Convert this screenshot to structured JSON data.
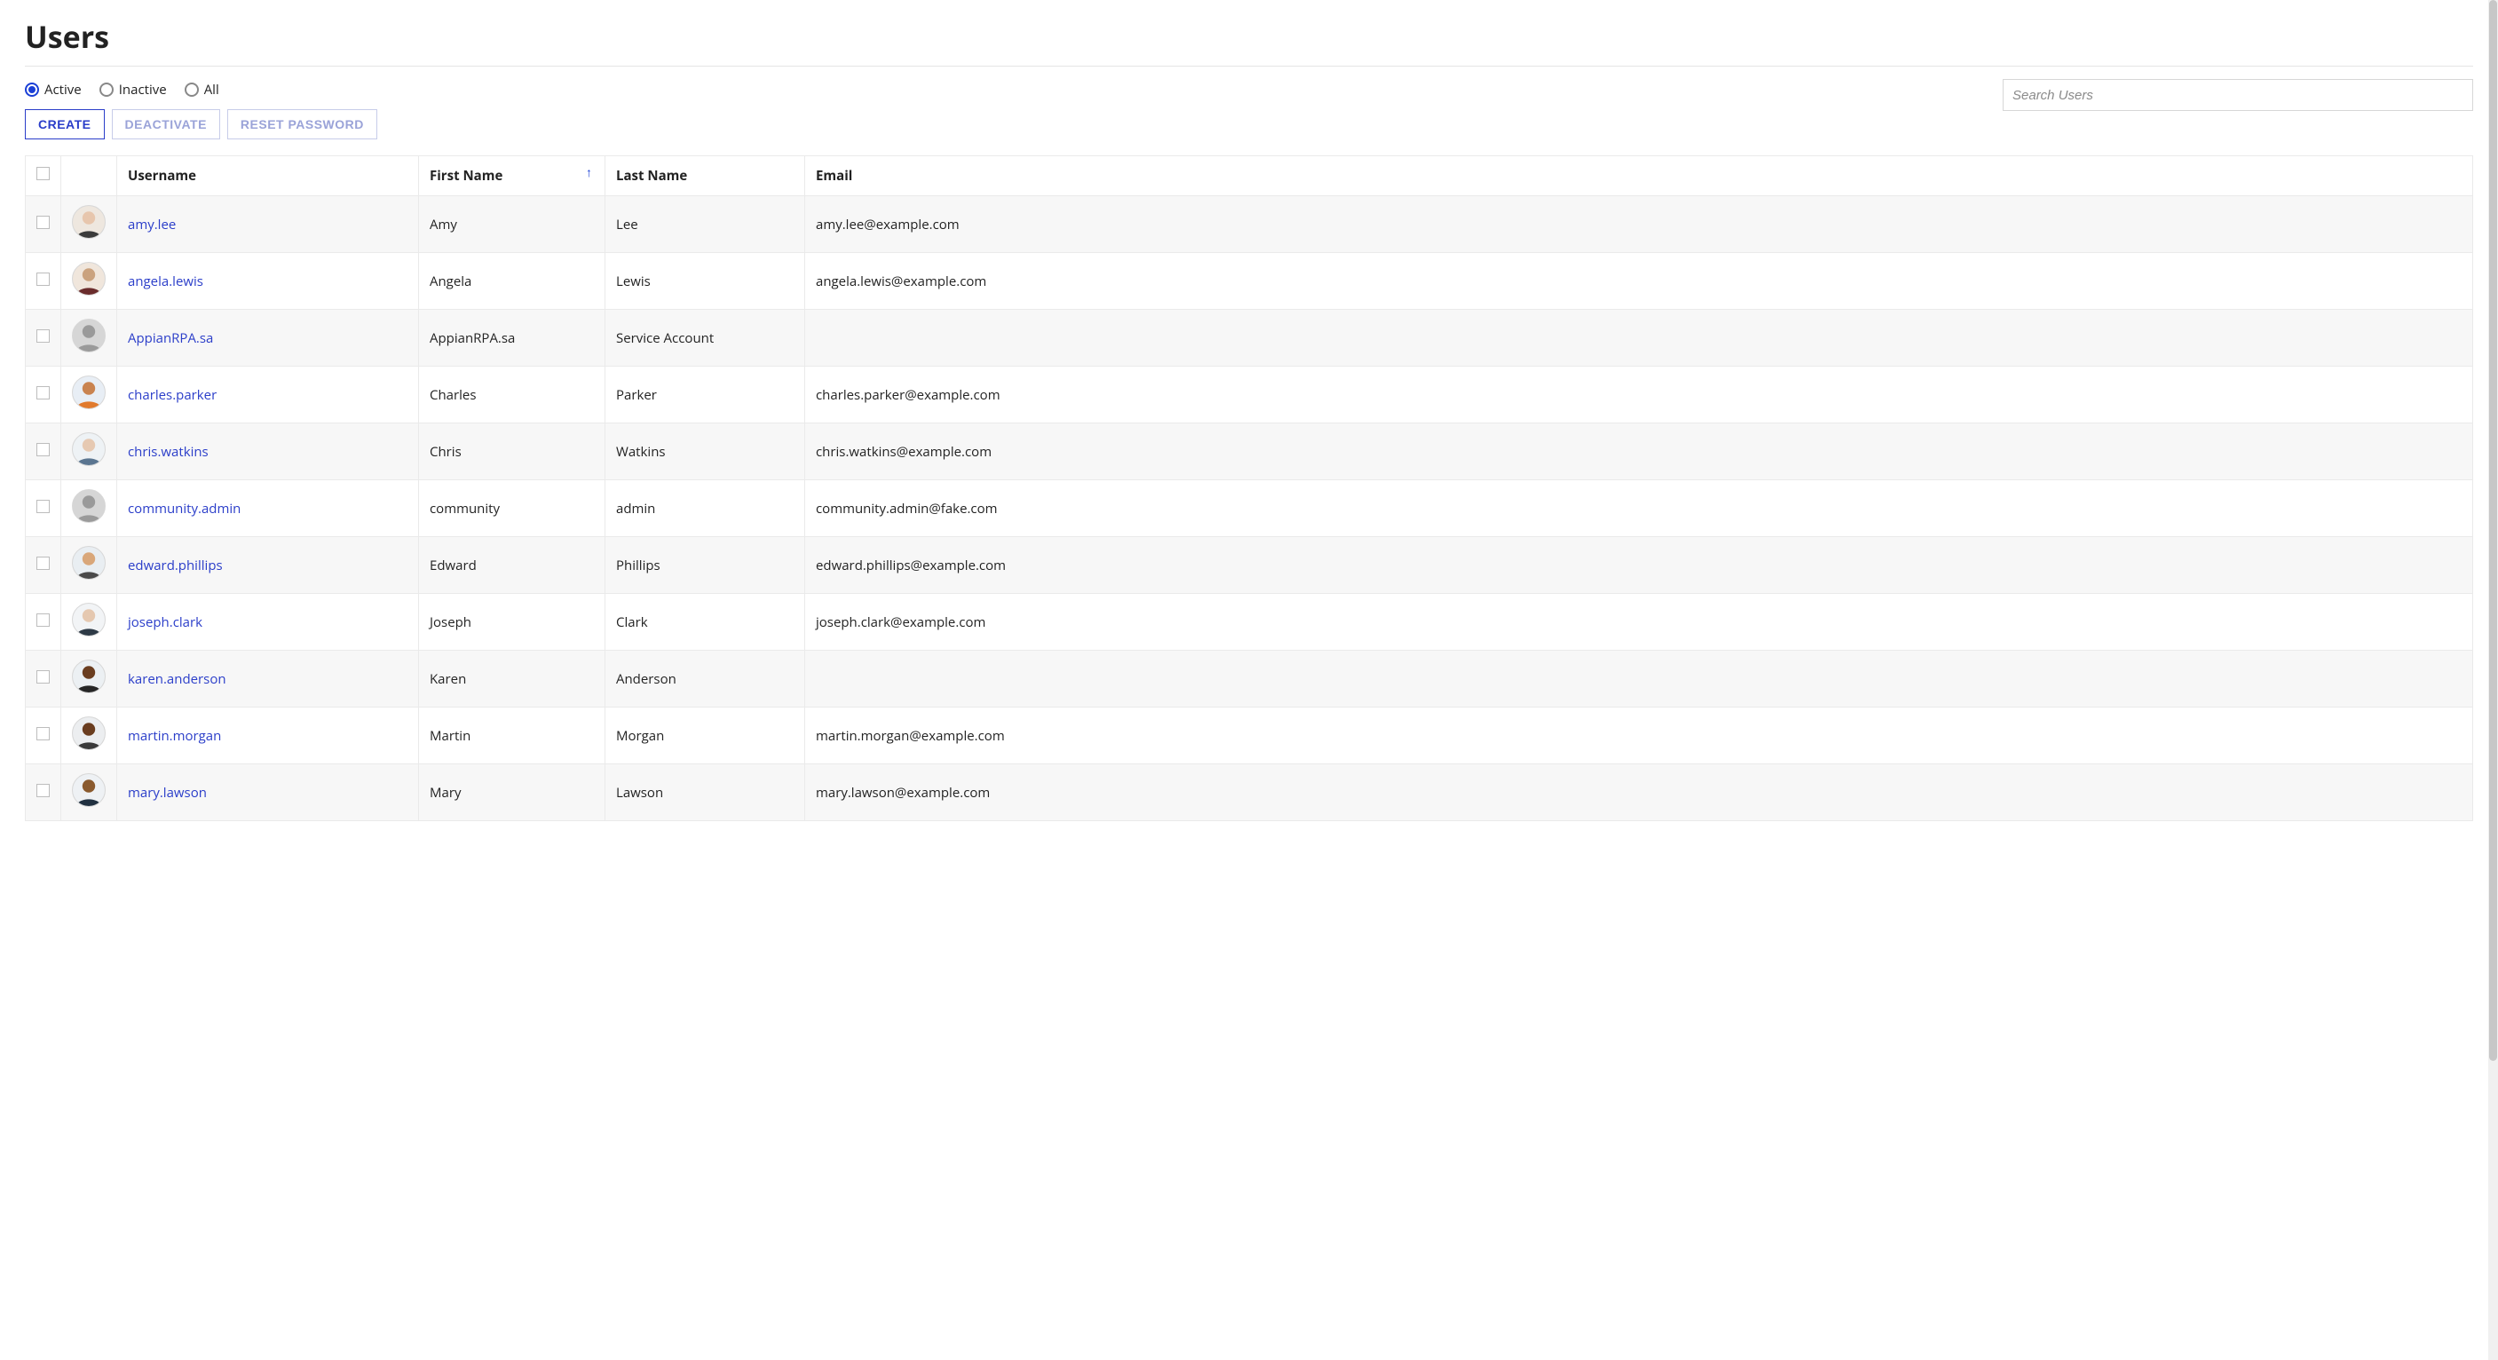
{
  "page": {
    "title": "Users"
  },
  "filters": {
    "radios": [
      {
        "label": "Active",
        "selected": true
      },
      {
        "label": "Inactive",
        "selected": false
      },
      {
        "label": "All",
        "selected": false
      }
    ]
  },
  "buttons": {
    "create": "Create",
    "deactivate": "Deactivate",
    "reset_password": "Reset Password"
  },
  "search": {
    "placeholder": "Search Users",
    "value": ""
  },
  "table": {
    "columns": {
      "username": "Username",
      "first_name": "First Name",
      "last_name": "Last Name",
      "email": "Email"
    },
    "sort": {
      "column": "first_name",
      "dir": "asc",
      "icon": "↑"
    },
    "rows": [
      {
        "username": "amy.lee",
        "first_name": "Amy",
        "last_name": "Lee",
        "email": "amy.lee@example.com",
        "avatar": "photo1"
      },
      {
        "username": "angela.lewis",
        "first_name": "Angela",
        "last_name": "Lewis",
        "email": "angela.lewis@example.com",
        "avatar": "photo2"
      },
      {
        "username": "AppianRPA.sa",
        "first_name": "AppianRPA.sa",
        "last_name": "Service Account",
        "email": "",
        "avatar": "silhouette"
      },
      {
        "username": "charles.parker",
        "first_name": "Charles",
        "last_name": "Parker",
        "email": "charles.parker@example.com",
        "avatar": "photo3"
      },
      {
        "username": "chris.watkins",
        "first_name": "Chris",
        "last_name": "Watkins",
        "email": "chris.watkins@example.com",
        "avatar": "photo4"
      },
      {
        "username": "community.admin",
        "first_name": "community",
        "last_name": "admin",
        "email": "community.admin@fake.com",
        "avatar": "silhouette"
      },
      {
        "username": "edward.phillips",
        "first_name": "Edward",
        "last_name": "Phillips",
        "email": "edward.phillips@example.com",
        "avatar": "photo5"
      },
      {
        "username": "joseph.clark",
        "first_name": "Joseph",
        "last_name": "Clark",
        "email": "joseph.clark@example.com",
        "avatar": "photo6"
      },
      {
        "username": "karen.anderson",
        "first_name": "Karen",
        "last_name": "Anderson",
        "email": "",
        "avatar": "photo7"
      },
      {
        "username": "martin.morgan",
        "first_name": "Martin",
        "last_name": "Morgan",
        "email": "martin.morgan@example.com",
        "avatar": "photo8"
      },
      {
        "username": "mary.lawson",
        "first_name": "Mary",
        "last_name": "Lawson",
        "email": "mary.lawson@example.com",
        "avatar": "photo9"
      }
    ]
  },
  "avatar_palette": {
    "photo1": {
      "bg": "#eee7df",
      "head": "#e7c6ad",
      "body": "#3b3b3b"
    },
    "photo2": {
      "bg": "#f0e6dc",
      "head": "#caa27e",
      "body": "#6a2c2c"
    },
    "photo3": {
      "bg": "#e8eef5",
      "head": "#c9834f",
      "body": "#e17a2d"
    },
    "photo4": {
      "bg": "#eef2f5",
      "head": "#e6c9b2",
      "body": "#5a7590"
    },
    "photo5": {
      "bg": "#e9eef2",
      "head": "#d9a77a",
      "body": "#4a4a4a"
    },
    "photo6": {
      "bg": "#f2f4f6",
      "head": "#e5c8b0",
      "body": "#2e3a46"
    },
    "photo7": {
      "bg": "#ecf0f3",
      "head": "#6a3d1f",
      "body": "#262626"
    },
    "photo8": {
      "bg": "#eceef0",
      "head": "#6a3d1f",
      "body": "#3a3a3a"
    },
    "photo9": {
      "bg": "#eef1f4",
      "head": "#8a5a2e",
      "body": "#203040"
    },
    "silhouette": {
      "bg": "#d6d6d6",
      "head": "#9a9a9a",
      "body": "#9a9a9a"
    }
  }
}
